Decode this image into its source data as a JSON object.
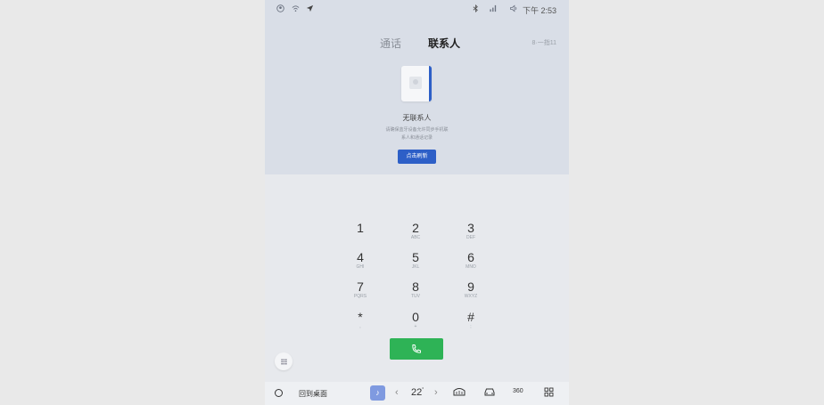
{
  "status_bar": {
    "icons": [
      "account-icon",
      "wifi-icon",
      "location-arrow-icon",
      "bluetooth-icon",
      "signal-icon",
      "volume-icon"
    ],
    "time": "下午 2:53"
  },
  "tabs": [
    {
      "label": "通话",
      "active": false
    },
    {
      "label": "联系人",
      "active": true
    }
  ],
  "top_right_text": "8·一指11",
  "empty_state": {
    "title": "无联系人",
    "hint_line1": "请确保蓝牙设备允许同步手机联",
    "hint_line2": "系人和通话记录",
    "button_label": "点击刷新"
  },
  "keypad": [
    {
      "digit": "1",
      "letters": ""
    },
    {
      "digit": "2",
      "letters": "ABC"
    },
    {
      "digit": "3",
      "letters": "DEF"
    },
    {
      "digit": "4",
      "letters": "GHI"
    },
    {
      "digit": "5",
      "letters": "JKL"
    },
    {
      "digit": "6",
      "letters": "MNO"
    },
    {
      "digit": "7",
      "letters": "PQRS"
    },
    {
      "digit": "8",
      "letters": "TUV"
    },
    {
      "digit": "9",
      "letters": "WXYZ"
    },
    {
      "digit": "*",
      "letters": ","
    },
    {
      "digit": "0",
      "letters": "+"
    },
    {
      "digit": "#",
      "letters": ";"
    }
  ],
  "dock": {
    "home_label": "回到桌面",
    "temperature": "22",
    "temperature_unit": "°",
    "icons": [
      "home-circle-icon",
      "music-note-icon",
      "chevron-left-icon",
      "chevron-right-icon",
      "rear-defrost-icon",
      "car-icon",
      "camera-360-icon",
      "apps-grid-icon"
    ],
    "camera_label": "360"
  },
  "colors": {
    "accent": "#2d5fc7",
    "call_green": "#2eb356"
  }
}
